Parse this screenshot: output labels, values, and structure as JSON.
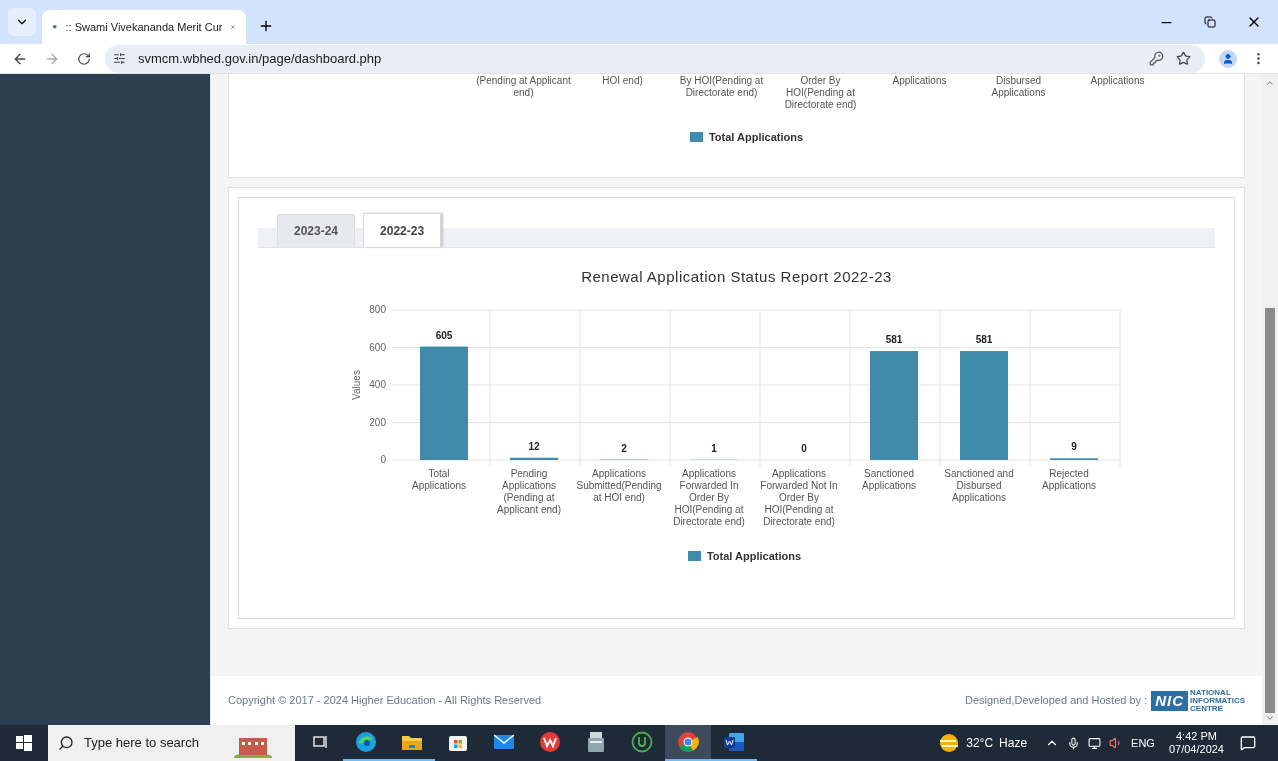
{
  "browser": {
    "tab_title": ":: Swami Vivekananda Merit Cur",
    "url": "svmcm.wbhed.gov.in/page/dashboard.php"
  },
  "top_chart": {
    "axis_labels": [
      "(Pending at Applicant end)",
      "HOI end)",
      "By HOI(Pending at Directorate end)",
      "Order By HOI(Pending at Directorate end)",
      "Applications",
      "Disbursed Applications",
      "Applications"
    ],
    "legend": "Total Applications"
  },
  "report": {
    "tabs": [
      {
        "label": "2023-24",
        "selected": false
      },
      {
        "label": "2022-23",
        "selected": true
      }
    ],
    "chart_data": {
      "type": "bar",
      "title": "Renewal Application Status Report 2022-23",
      "ylabel": "Values",
      "categories": [
        "Total Applications",
        "Pending Applications (Pending at Applicant end)",
        "Applications Submitted(Pending at HOI end)",
        "Applications Forwarded In Order By HOI(Pending at Directorate end)",
        "Applications Forwarded Not In Order By HOI(Pending at Directorate end)",
        "Sanctioned Applications",
        "Sanctioned and Disbursed Applications",
        "Rejected Applications"
      ],
      "series": [
        {
          "name": "Total Applications",
          "color": "#3f8ba9",
          "values": [
            605,
            12,
            2,
            1,
            0,
            581,
            581,
            9
          ]
        }
      ],
      "ylim": [
        0,
        800
      ],
      "yticks": [
        0,
        200,
        400,
        600,
        800
      ],
      "grid": true,
      "data_labels": true
    }
  },
  "footer": {
    "copyright": "Copyright © 2017 - 2024 Higher Education - All Rights Reserved",
    "credit": "Designed,Developed and Hosted by :",
    "logo_mark": "NIC",
    "logo_text": [
      "NATIONAL",
      "INFORMATICS",
      "CENTRE"
    ]
  },
  "taskbar": {
    "search_placeholder": "Type here to search",
    "apps": [
      {
        "kind": "taskview",
        "active": false,
        "running": false
      },
      {
        "kind": "edge",
        "active": false,
        "running": true
      },
      {
        "kind": "explorer",
        "active": false,
        "running": true
      },
      {
        "kind": "store",
        "active": false,
        "running": false
      },
      {
        "kind": "mail",
        "active": false,
        "running": false
      },
      {
        "kind": "wps",
        "active": false,
        "running": false
      },
      {
        "kind": "scanner",
        "active": false,
        "running": false
      },
      {
        "kind": "u",
        "active": false,
        "running": false
      },
      {
        "kind": "chrome",
        "active": true,
        "running": true
      },
      {
        "kind": "word",
        "active": false,
        "running": true
      }
    ],
    "weather_temp": "32°C",
    "weather_text": "Haze",
    "language": "ENG",
    "time": "4:42 PM",
    "date": "07/04/2024"
  }
}
